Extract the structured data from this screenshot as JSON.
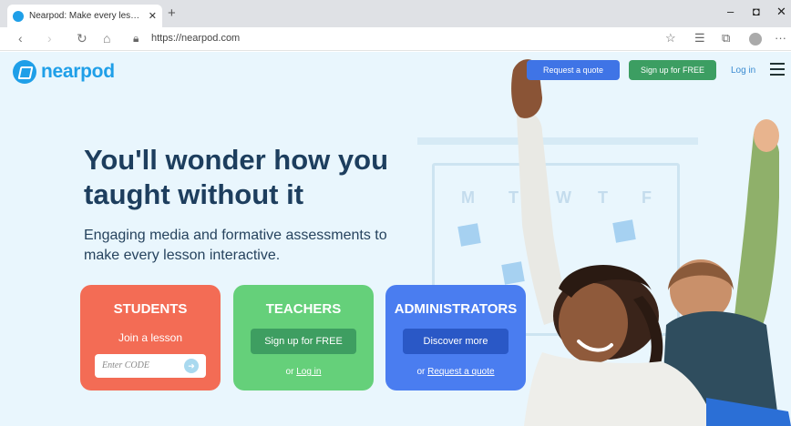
{
  "browser": {
    "tab_title": "Nearpod: Make every lesson inte",
    "tab_close": "✕",
    "new_tab": "+",
    "url": "https://nearpod.com",
    "win_min": "–",
    "win_max": "◘",
    "win_close": "✕",
    "back": "‹",
    "forward": "›",
    "refresh": "↻",
    "home": "⌂",
    "more": "···"
  },
  "header": {
    "logo_text": "nearpod",
    "request_quote": "Request a quote",
    "signup": "Sign up for FREE",
    "login": "Log in"
  },
  "board_days": [
    "M",
    "T",
    "W",
    "T",
    "F"
  ],
  "hero": {
    "headline": "You'll wonder how you taught without it",
    "subhead": "Engaging media and formative assessments to make every lesson interactive."
  },
  "cards": {
    "students": {
      "title": "STUDENTS",
      "subtitle": "Join a lesson",
      "placeholder": "Enter CODE",
      "go": "➜"
    },
    "teachers": {
      "title": "TEACHERS",
      "button": "Sign up for FREE",
      "foot_prefix": "or",
      "foot_link": "Log in"
    },
    "administrators": {
      "title": "ADMINISTRATORS",
      "button": "Discover more",
      "foot_prefix": "or",
      "foot_link": "Request a quote"
    }
  },
  "colors": {
    "brand": "#1f9fe8",
    "students": "#f36c55",
    "teachers": "#65d07a",
    "administrators": "#4a7df0",
    "quote_button": "#3f74e6",
    "signup_button": "#3c9e62"
  },
  "icons": {
    "favicon": "nearpod-favicon",
    "lock": "lock-icon",
    "star": "star-icon",
    "favorites": "favorites-icon",
    "collections": "collections-icon",
    "profile": "profile-icon",
    "menu": "hamburger-icon"
  }
}
